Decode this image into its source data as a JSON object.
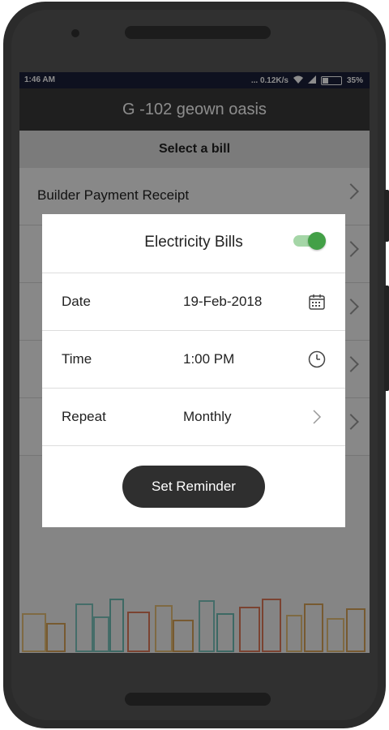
{
  "status_bar": {
    "time": "1:46 AM",
    "speed": "... 0.12K/s",
    "battery": "35%"
  },
  "app_bar": {
    "title": "G -102 geown oasis"
  },
  "subheader": {
    "title": "Select a bill"
  },
  "bill_list": [
    {
      "label": "Builder Payment Receipt"
    },
    {
      "label": ""
    },
    {
      "label": ""
    },
    {
      "label": ""
    },
    {
      "label": ""
    }
  ],
  "modal": {
    "title": "Electricity Bills",
    "toggle_on": true,
    "rows": [
      {
        "label": "Date",
        "value": "19-Feb-2018",
        "icon": "calendar-icon"
      },
      {
        "label": "Time",
        "value": "1:00 PM",
        "icon": "clock-icon"
      },
      {
        "label": "Repeat",
        "value": "Monthly",
        "icon": "chevron-right-icon"
      }
    ],
    "button_label": "Set Reminder"
  },
  "colors": {
    "status_bar": "#1a1f3a",
    "toggle_on": "#43a047",
    "button": "#2f2f2f"
  }
}
